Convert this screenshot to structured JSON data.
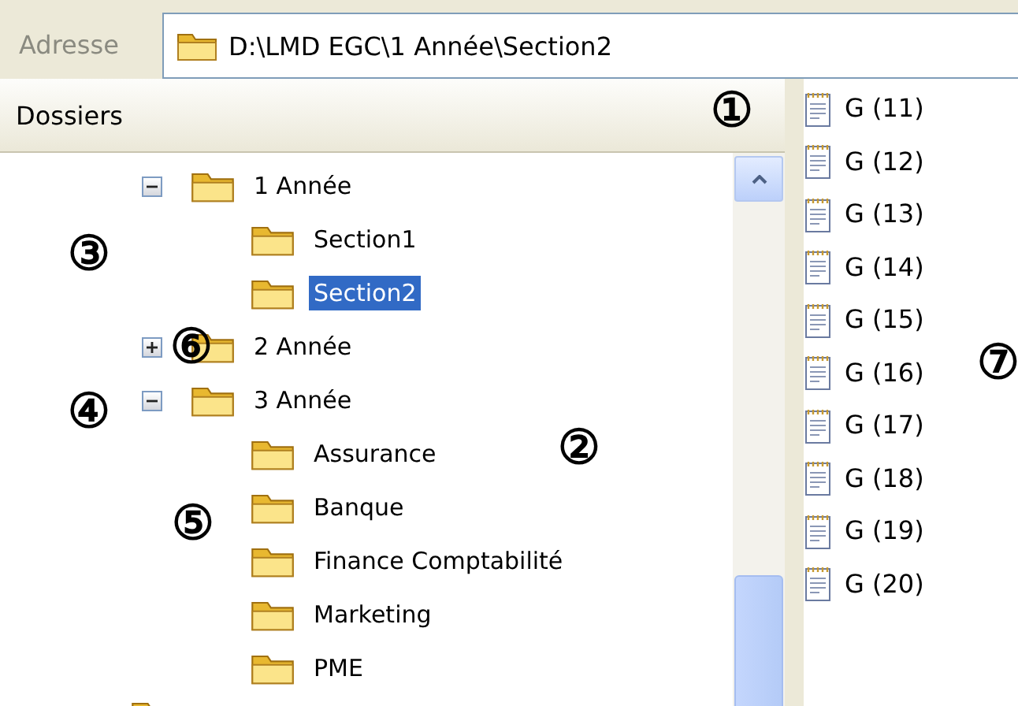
{
  "address_bar": {
    "label": "Adresse",
    "path": "D:\\LMD EGC\\1 Année\\Section2"
  },
  "folders_pane": {
    "title": "Dossiers",
    "tree": [
      {
        "label": "1 Année",
        "expanded": true,
        "selected": false,
        "children": [
          {
            "label": "Section1",
            "selected": false
          },
          {
            "label": "Section2",
            "selected": true
          }
        ]
      },
      {
        "label": "2 Année",
        "expanded": false,
        "selected": false
      },
      {
        "label": "3 Année",
        "expanded": true,
        "selected": false,
        "children": [
          {
            "label": "Assurance",
            "selected": false
          },
          {
            "label": "Banque",
            "selected": false
          },
          {
            "label": "Finance Comptabilité",
            "selected": false
          },
          {
            "label": "Marketing",
            "selected": false
          },
          {
            "label": "PME",
            "selected": false
          }
        ]
      }
    ]
  },
  "files": [
    "G (11)",
    "G (12)",
    "G (13)",
    "G (14)",
    "G (15)",
    "G (16)",
    "G (17)",
    "G (18)",
    "G (19)",
    "G (20)"
  ],
  "callouts": [
    "①",
    "②",
    "③",
    "④",
    "⑤",
    "⑥",
    "⑦"
  ]
}
